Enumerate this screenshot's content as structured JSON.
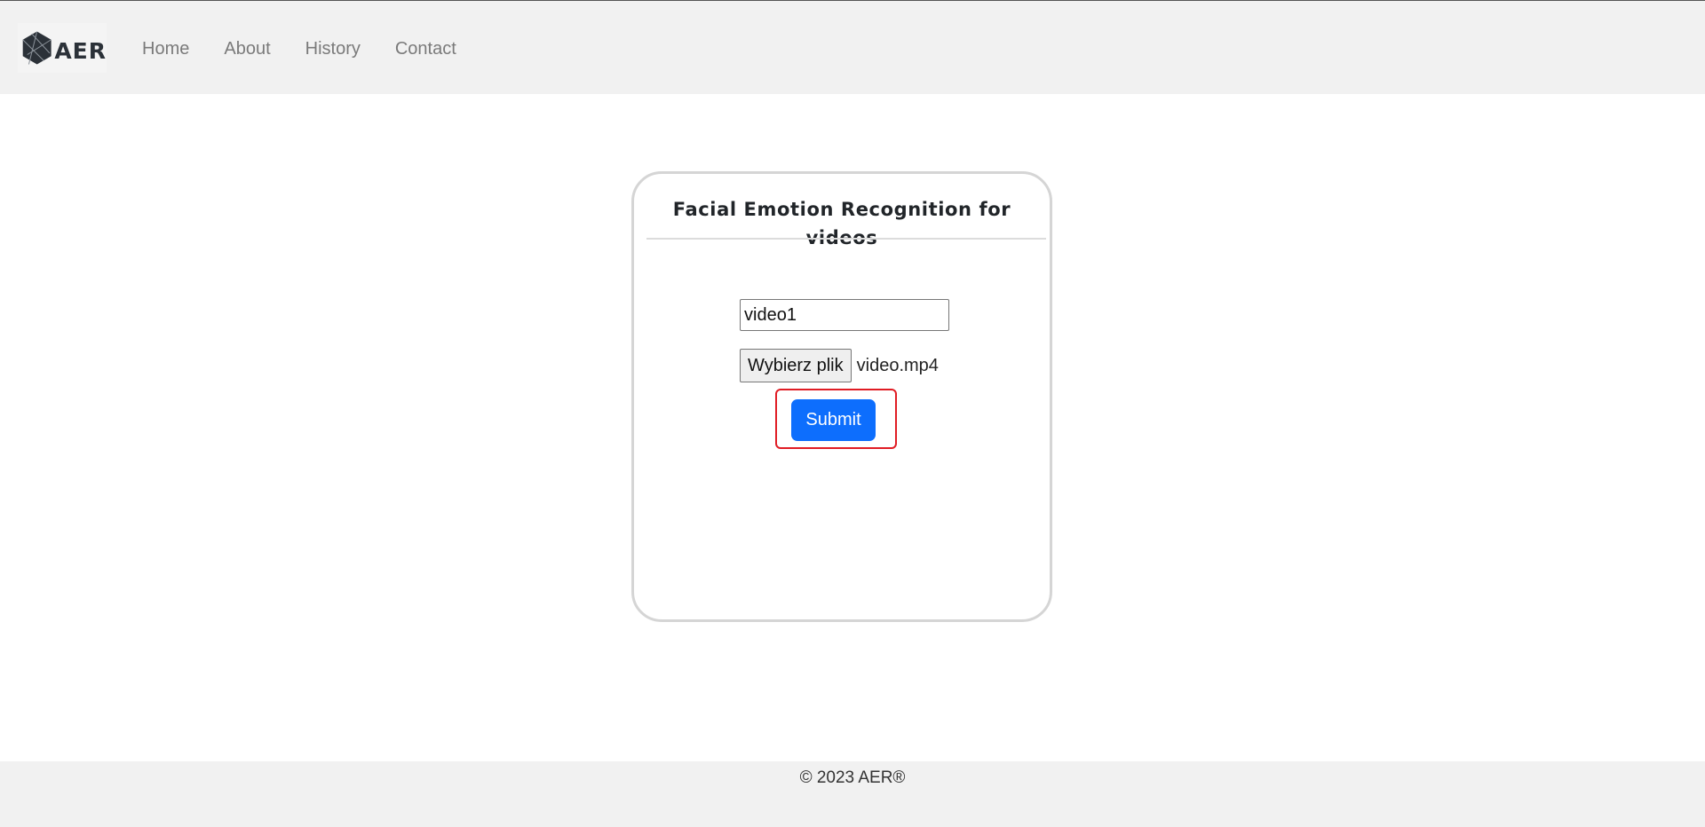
{
  "header": {
    "logo_text": "AER",
    "nav": [
      {
        "label": "Home"
      },
      {
        "label": "About"
      },
      {
        "label": "History"
      },
      {
        "label": "Contact"
      }
    ]
  },
  "card": {
    "title": "Facial Emotion Recognition for videos",
    "name_input_value": "video1",
    "file_button_label": "Wybierz plik",
    "file_name": "video.mp4",
    "submit_label": "Submit"
  },
  "footer": {
    "text": "© 2023 AER®"
  },
  "colors": {
    "navbar_bg": "#f1f1f1",
    "nav_link": "#7a7a7a",
    "primary": "#0d6efd",
    "highlight": "#e01c24",
    "card_border": "#d5d5d5"
  },
  "icons": {
    "logo": "polyhedron-logo-icon"
  }
}
